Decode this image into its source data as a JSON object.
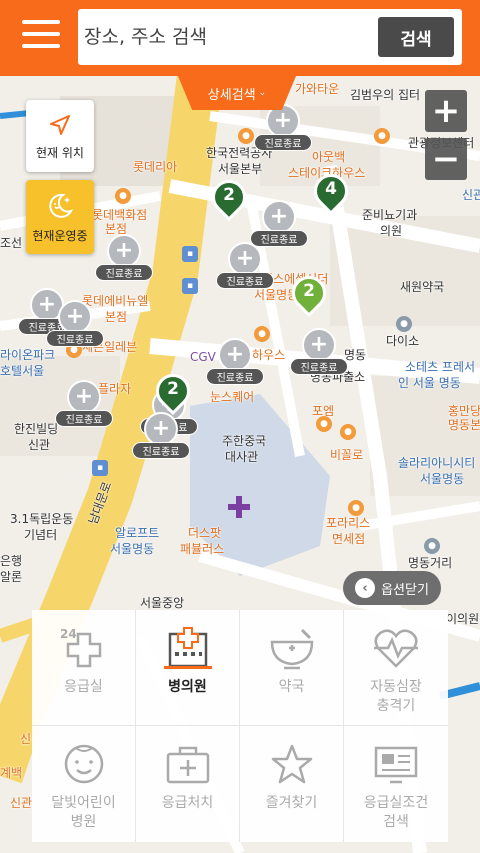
{
  "header": {
    "search_placeholder": "장소, 주소 검색",
    "search_button": "검색",
    "detail_search_tab": "상세검색"
  },
  "map_controls": {
    "current_location": "현재 위치",
    "open_now": "현재운영중",
    "zoom_in": "+",
    "zoom_out": "−",
    "options_close": "옵션닫기"
  },
  "markers": {
    "closed_label": "진료종료",
    "clusters": [
      "2",
      "4",
      "2",
      "2"
    ]
  },
  "map_labels": {
    "l1": "가와타운",
    "l2": "김범우의 집터",
    "l3": "롯데리아",
    "l4": "한국전력공사",
    "l5": "서울본부",
    "l6": "아웃백",
    "l7": "스테이크하우스",
    "l8": "롯데백화점",
    "l9": "본점",
    "l10": "준비뇨기과",
    "l11": "의원",
    "l12": "비스에셀서더",
    "l13": "서울명동",
    "l14": "롯데에비뉴엘",
    "l15": "본점",
    "l16": "새원약국",
    "l17": "세븐일레븐",
    "l18": "CGV",
    "l19": "하우스",
    "l20": "명동",
    "l21": "다이소",
    "l22": "라이온파크",
    "l23": "호텔서울",
    "l24": "명동파출소",
    "l25": "소테츠 프레서",
    "l26": "인 서울 명동",
    "l27": "눈스퀘어",
    "l28": "포엠",
    "l29": "홍만당",
    "l30": "명동본",
    "l31": "한진빌딩",
    "l32": "신관",
    "l33": "주한중국",
    "l34": "대사관",
    "l35": "비꼴로",
    "l36": "솔라리아니시티",
    "l37": "서울명동",
    "l38": "3.1독립운동",
    "l39": "기념터",
    "l40": "알로프트",
    "l41": "서울명동",
    "l42": "더스팟",
    "l43": "패뷸러스",
    "l44": "포라리스",
    "l45": "면세점",
    "l46": "명동거리",
    "l47": "남대문로",
    "l48": "서울중앙",
    "l49": "은행",
    "l50": "알론",
    "l51": "관광정보센터",
    "l52": "조선",
    "l53": "이의원",
    "l54": "플라자",
    "l55": "신관",
    "l56": "신",
    "l57": "계백",
    "l58": "신관"
  },
  "quick_menu": [
    {
      "label": "응급실",
      "icon": "emergency-24-icon",
      "active": false
    },
    {
      "label": "병의원",
      "icon": "hospital-icon",
      "active": true
    },
    {
      "label": "약국",
      "icon": "pharmacy-bowl-icon",
      "active": false
    },
    {
      "label": "자동심장\n충격기",
      "icon": "defibrillator-heart-icon",
      "active": false
    },
    {
      "label": "달빛어린이\n병원",
      "icon": "child-face-icon",
      "active": false
    },
    {
      "label": "응급처치",
      "icon": "first-aid-kit-icon",
      "active": false
    },
    {
      "label": "즐겨찾기",
      "icon": "star-icon",
      "active": false
    },
    {
      "label": "응급실조건\n검색",
      "icon": "monitor-icon",
      "active": false
    }
  ],
  "colors": {
    "brand": "#f86b1a",
    "cluster_dark": "#2a6b32",
    "cluster_light": "#6fb13a",
    "night_care": "#f7c12c"
  }
}
